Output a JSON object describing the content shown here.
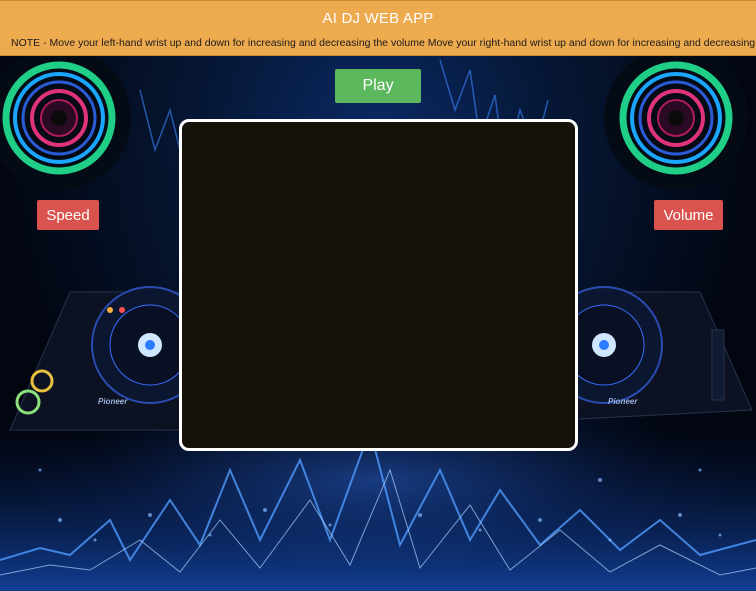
{
  "app": {
    "title": "AI DJ WEB APP",
    "note": "NOTE - Move your left-hand wrist up and down for increasing and decreasing the volume Move your right-hand wrist up and down for increasing and decreasing"
  },
  "controls": {
    "play_label": "Play",
    "speed_label": "Speed",
    "volume_label": "Volume"
  },
  "decks": {
    "brand": "Pioneer"
  },
  "colors": {
    "header": "#eeaa4f",
    "play": "#5cb85c",
    "badge": "#d9534f",
    "webcam_bg": "#161109"
  },
  "icons": [
    "speaker-ring-left-icon",
    "speaker-ring-right-icon"
  ]
}
